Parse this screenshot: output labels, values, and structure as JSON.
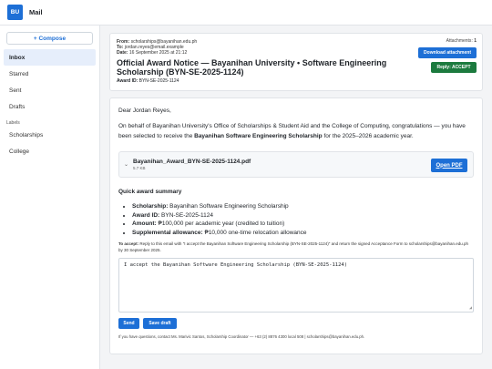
{
  "app": {
    "logo": "BU",
    "title": "Mail"
  },
  "sidebar": {
    "compose_label": "+ Compose",
    "items": [
      {
        "label": "Inbox",
        "active": true
      },
      {
        "label": "Starred"
      },
      {
        "label": "Sent"
      },
      {
        "label": "Drafts"
      }
    ],
    "labels_heading": "Labels",
    "labels": [
      {
        "label": "Scholarships"
      },
      {
        "label": "College"
      }
    ]
  },
  "email": {
    "from_label": "From:",
    "from": "scholarships@bayanihan.edu.ph",
    "to_label": "To:",
    "to": "jordan.reyes@email.example",
    "date_label": "Date:",
    "date": "16 September 2025 at 21:12",
    "subject": "Official Award Notice — Bayanihan University • Software Engineering Scholarship (BYN-SE-2025-1124)",
    "award_id_label": "Award ID:",
    "award_id": "BYN-SE-2025-1124",
    "attachments_label": "Attachments",
    "attachments_count": "1",
    "download_label": "Download attachment",
    "reply_accept_label": "Reply: ACCEPT",
    "greeting": "Dear Jordan Reyes,",
    "para_1": "On behalf of Bayanihan University's Office of Scholarships & Student Aid and the College of Computing, congratulations — you have been selected to receive the ",
    "para_bold": "Bayanihan Software Engineering Scholarship",
    "para_2": " for the 2025–2026 academic year.",
    "attachment": {
      "name": "Bayanihan_Award_BYN-SE-2025-1124.pdf",
      "size": "5.7 KB",
      "open_label": "Open PDF"
    },
    "summary_title": "Quick award summary",
    "summary": [
      {
        "key": "Scholarship:",
        "value": " Bayanihan Software Engineering Scholarship"
      },
      {
        "key": "Award ID:",
        "value": " BYN-SE-2025-1124"
      },
      {
        "key": "Amount:",
        "value": " ₱100,000 per academic year (credited to tuition)"
      },
      {
        "key": "Supplemental allowance:",
        "value": " ₱10,000 one-time relocation allowance"
      }
    ],
    "accept_bold": "To accept:",
    "accept_text": " Reply to this email with \"I accept the Bayanihan Software Engineering Scholarship (BYN-SE-2025-1124)\" and return the signed Acceptance Form to scholarships@bayanihan.edu.ph by 30 September 2025.",
    "reply_value": "I accept the Bayanihan Software Engineering Scholarship (BYN-SE-2025-1124)",
    "send_label": "Send",
    "save_draft_label": "Save draft",
    "footer": "If you have questions, contact Ms. Marivic Santos, Scholarship Coordinator — +63 (2) 8876 4300 local 508 | scholarships@bayanihan.edu.ph."
  },
  "colors": {
    "accent": "#1d6fd6",
    "accept": "#1c7a3e",
    "active_nav": "#e6eefb"
  }
}
